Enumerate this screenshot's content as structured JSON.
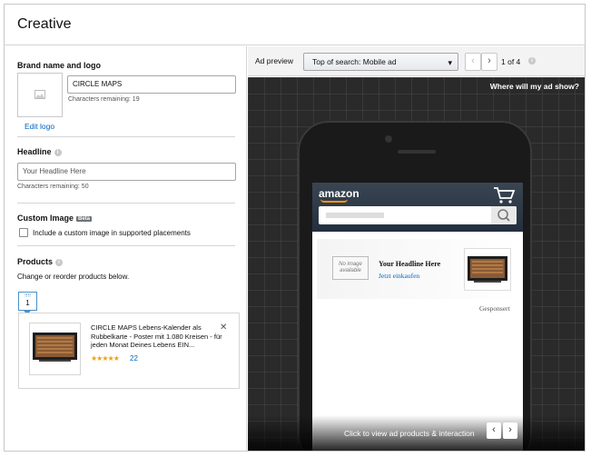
{
  "header": {
    "title": "Creative"
  },
  "brand": {
    "label": "Brand name and logo",
    "name_value": "CIRCLE MAPS",
    "chars_remaining": "Characters remaining: 19",
    "edit_logo": "Edit logo"
  },
  "headline": {
    "label": "Headline",
    "placeholder": "Your Headline Here",
    "chars_remaining": "Characters remaining: 50"
  },
  "custom_image": {
    "label": "Custom Image",
    "badge": "Beta",
    "checkbox_label": "Include a custom image in supported placements",
    "checked": false
  },
  "products": {
    "label": "Products",
    "hint": "Change or reorder products below.",
    "tab_number": "1",
    "items": [
      {
        "title": "CIRCLE MAPS Lebens-Kalender als Rubbelkarte - Poster mit 1.080 Kreisen - für jeden Monat Deines Lebens EIN...",
        "rating": 4.5,
        "stars": "★★★★★",
        "reviews": "22"
      }
    ]
  },
  "preview": {
    "label": "Ad preview",
    "placement": "Top of search: Mobile ad",
    "pager": "1 of 4",
    "where_link": "Where will my ad show?",
    "amazon_logo": "amazon",
    "ad_headline": "Your Headline Here",
    "ad_cta": "Jetzt einkaufen",
    "no_image": "No image available",
    "sponsored": "Gesponsert",
    "bottom_text": "Click to view ad products & interaction"
  },
  "colors": {
    "link": "#0066c0",
    "star": "#e8a317",
    "amazon_bar": "#232f3e"
  }
}
